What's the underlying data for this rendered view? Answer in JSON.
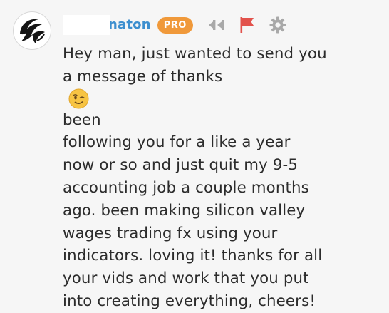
{
  "comment": {
    "username": "naton",
    "badge": "PRO",
    "actions": {
      "reply_icon": "reply-quote-icon",
      "flag_icon": "flag-icon",
      "settings_icon": "gear-icon"
    },
    "body_lines": [
      "Hey man, just wanted to send you",
      "a message of thanks",
      "been",
      "following you for a like a year",
      "now or so and just quit my 9-5",
      "accounting job a couple months",
      "ago. been making silicon valley",
      "wages trading fx using your",
      "indicators. loving it! thanks for all",
      "your vids and work that you put",
      "into creating everything, cheers!"
    ],
    "emoji": "winking-face-emoji"
  },
  "colors": {
    "username": "#3d8fcf",
    "badge": "#f0993a",
    "flag": "#e2524c",
    "icons": "#a9a9a9",
    "text": "#2c2c2c",
    "background": "#f6f6f6"
  }
}
